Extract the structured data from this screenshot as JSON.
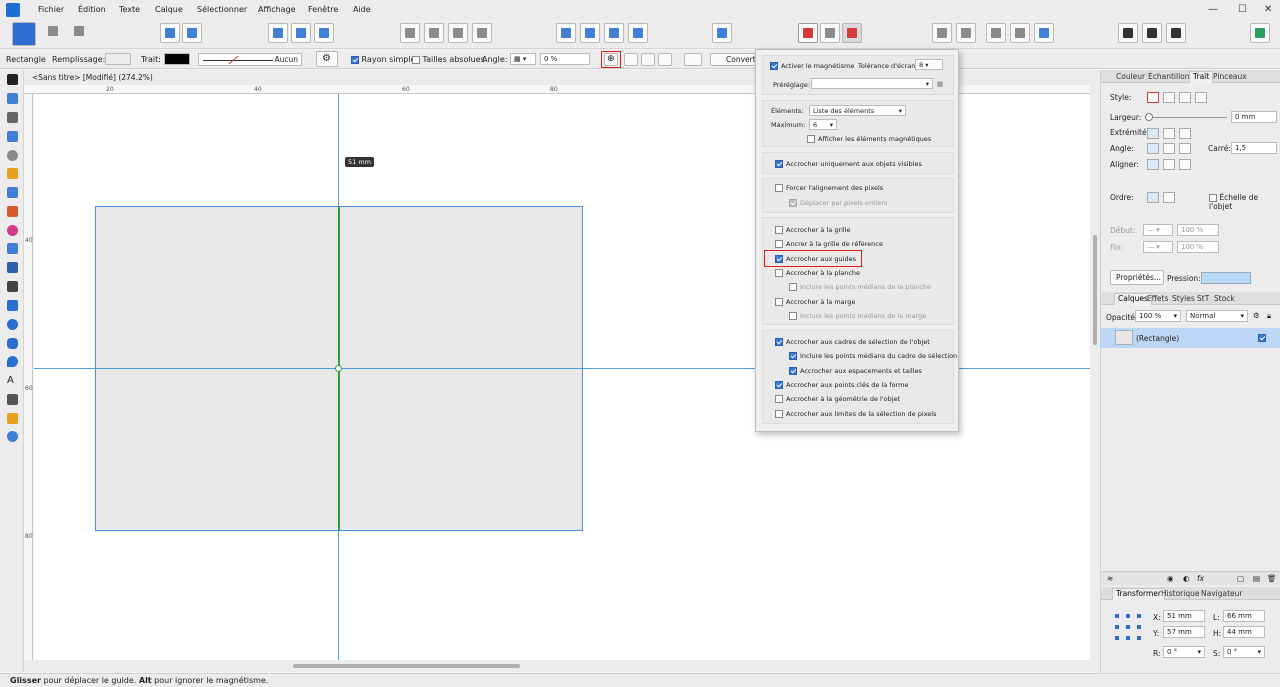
{
  "menubar": {
    "items": [
      "Fichier",
      "Édition",
      "Texte",
      "Calque",
      "Sélectionner",
      "Affichage",
      "Fenêtre",
      "Aide"
    ]
  },
  "context_toolbar": {
    "tool_name": "Rectangle",
    "fill_label": "Remplissage:",
    "stroke_label": "Trait:",
    "stroke_none": "Aucun",
    "rayon_simple": "Rayon simple",
    "tailles_absolues": "Tailles absolues",
    "angle_label": "Angle:",
    "angle_value": "0 %",
    "convert_label": "Convert"
  },
  "document": {
    "title": "<Sans titre> [Modifié] (274.2%)",
    "guide_tooltip": "51 mm"
  },
  "rulers": {
    "h_labels": [
      "20",
      "40",
      "60",
      "80"
    ],
    "v_labels": [
      "40",
      "60",
      "80"
    ]
  },
  "snapping": {
    "enable_label": "Activer le magnétisme",
    "tolerance_label": "Tolérance d'écran:",
    "tolerance_value": "8",
    "preset_label": "Préréglage:",
    "preset_value": "",
    "elements_label": "Éléments:",
    "elements_value": "Liste des éléments",
    "maximum_label": "Maximum:",
    "maximum_value": "6",
    "show_magnetic": "Afficher les éléments magnétiques",
    "visible_only": "Accrocher uniquement aux objets visibles",
    "force_pixel": "Forcer l'alignement des pixels",
    "move_whole_pixels": "Déplacer par pixels entiers",
    "grid": "Accrocher à la grille",
    "ref_grid": "Ancrer à la grille de référence",
    "guides": "Accrocher aux guides",
    "page": "Accrocher à la planche",
    "page_midpoints": "Inclure les points médians de la planche",
    "margin": "Accrocher à la marge",
    "margin_midpoints": "Inclure les points médians de la marge",
    "bbox": "Accrocher aux cadres de sélection de l'objet",
    "bbox_midpoints": "Inclure les points médians du cadre de sélection",
    "spacing": "Accrocher aux espacements et tailles",
    "key_points": "Accrocher aux points clés de la forme",
    "geometry": "Accrocher à la géométrie de l'objet",
    "pixel_bounds": "Accrocher aux limites de la sélection de pixels"
  },
  "stroke_panel": {
    "tabs": [
      "Couleur",
      "Échantillons",
      "Trait",
      "Pinceaux"
    ],
    "style_label": "Style:",
    "width_label": "Largeur:",
    "width_value": "0 mm",
    "cap_label": "Extrémité:",
    "join_label": "Angle:",
    "miter_label": "Carré:",
    "miter_value": "1,5",
    "align_label": "Aligner:",
    "order_label": "Ordre:",
    "scale_label": "Échelle de l'objet",
    "start_label": "Début:",
    "start_value": "100 %",
    "end_label": "Fin:",
    "end_value": "100 %",
    "properties_button": "Propriétés...",
    "pressure_label": "Pression:"
  },
  "layers_panel": {
    "tabs": [
      "Calques",
      "Effets",
      "Styles",
      "StT",
      "Stock"
    ],
    "opacity_label": "Opacité:",
    "opacity_value": "100 %",
    "blend_value": "Normal",
    "layer_name": "(Rectangle)"
  },
  "transform_panel": {
    "tabs": [
      "Transformer",
      "Historique",
      "Navigateur"
    ],
    "x_label": "X:",
    "x_value": "51 mm",
    "y_label": "Y:",
    "y_value": "57 mm",
    "w_label": "L:",
    "w_value": "66 mm",
    "h_label": "H:",
    "h_value": "44 mm",
    "r_label": "R:",
    "r_value": "0 °",
    "s_label": "S:",
    "s_value": "0 °"
  },
  "status": {
    "bold1": "Glisser",
    "text1": " pour déplacer le guide. ",
    "bold2": "Alt",
    "text2": " pour ignorer le magnétisme."
  }
}
